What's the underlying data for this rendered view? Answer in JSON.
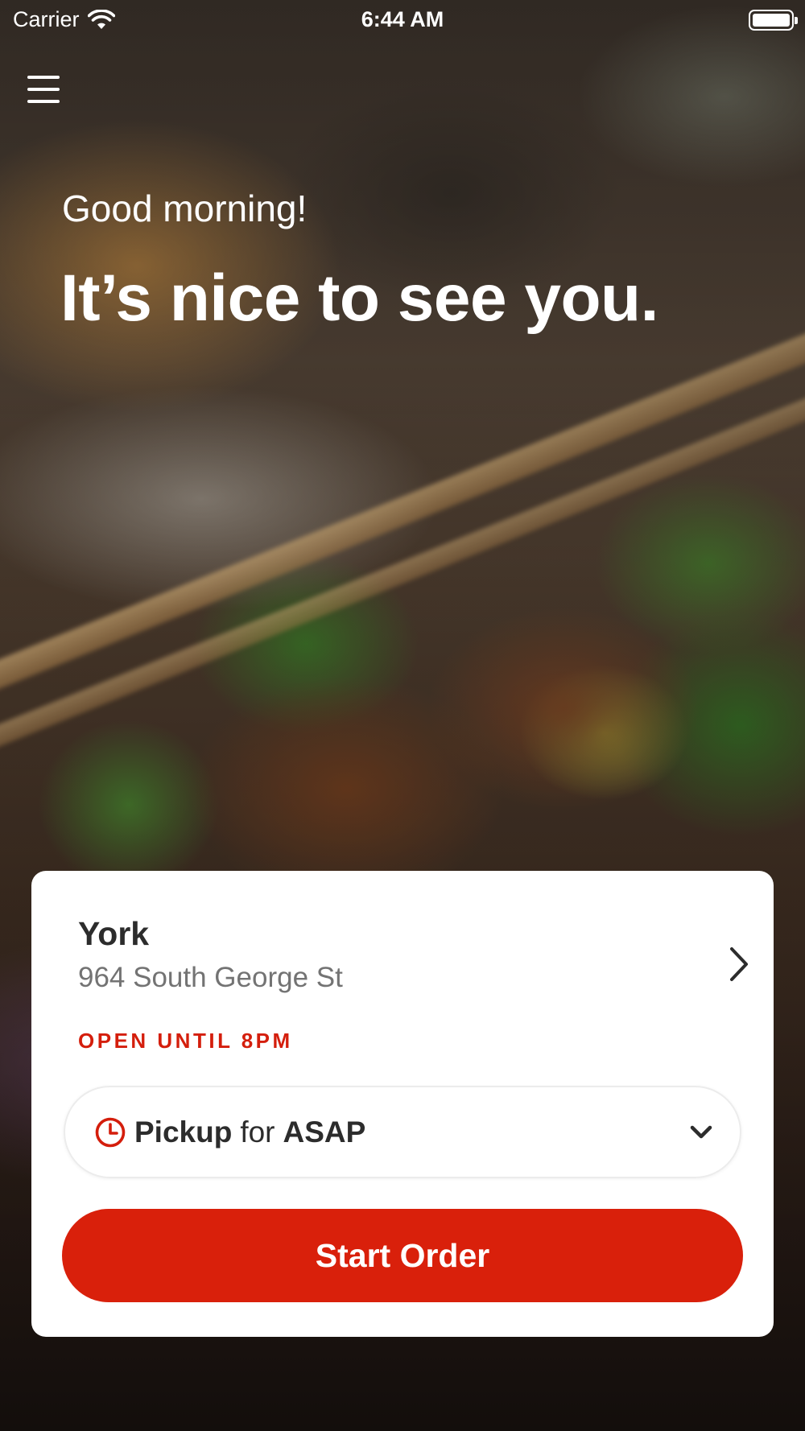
{
  "status_bar": {
    "carrier": "Carrier",
    "time": "6:44 AM",
    "wifi_icon": "wifi-icon",
    "battery_icon": "battery-full-icon"
  },
  "header": {
    "menu_icon": "hamburger-menu-icon"
  },
  "hero": {
    "greeting": "Good morning!",
    "headline": "It’s nice to see you."
  },
  "location": {
    "name": "York",
    "address": "964 South George St",
    "status": "OPEN UNTIL 8PM",
    "chevron_icon": "chevron-right-icon"
  },
  "order_mode": {
    "clock_icon": "clock-icon",
    "mode": "Pickup",
    "connector": "for",
    "time": "ASAP",
    "dropdown_icon": "chevron-down-icon"
  },
  "cta": {
    "label": "Start Order"
  },
  "colors": {
    "brand_red": "#d9200b",
    "status_red": "#d41e0c",
    "text_dark": "#2c2c2c",
    "text_muted": "#737373"
  }
}
